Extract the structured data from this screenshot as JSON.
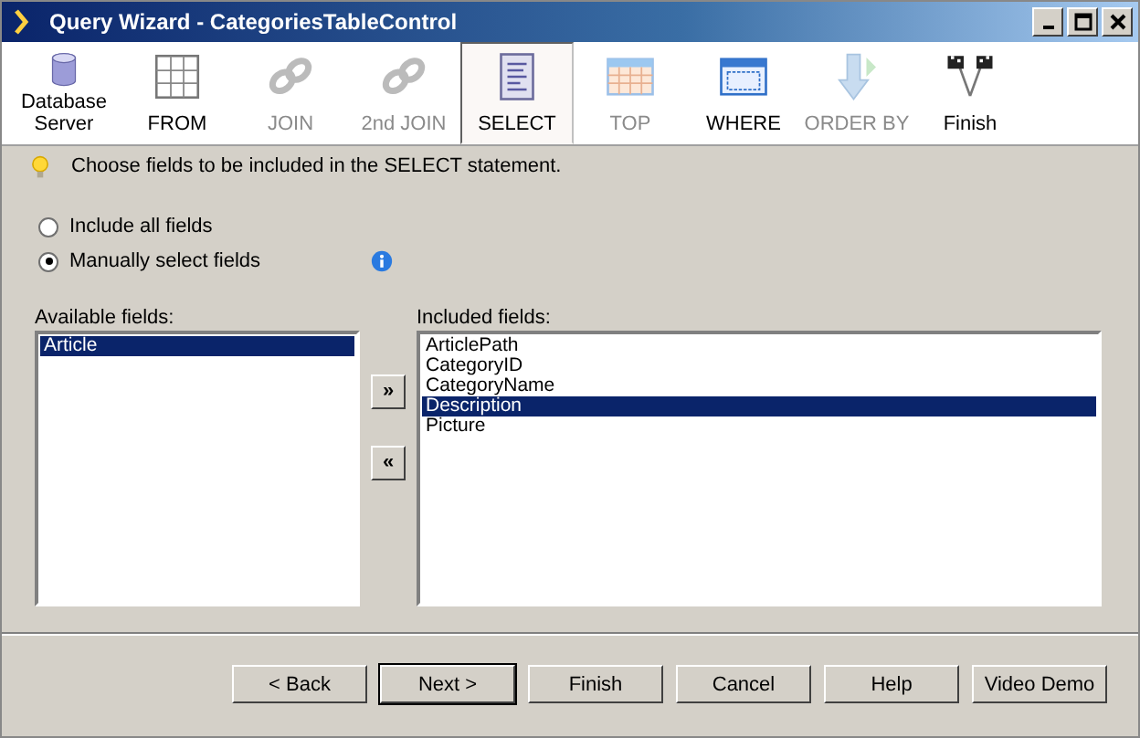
{
  "window": {
    "title": "Query Wizard - CategoriesTableControl"
  },
  "steps": [
    {
      "label": "Database Server",
      "disabled": false,
      "selected": false
    },
    {
      "label": "FROM",
      "disabled": false,
      "selected": false
    },
    {
      "label": "JOIN",
      "disabled": true,
      "selected": false
    },
    {
      "label": "2nd JOIN",
      "disabled": true,
      "selected": false
    },
    {
      "label": "SELECT",
      "disabled": false,
      "selected": true
    },
    {
      "label": "TOP",
      "disabled": true,
      "selected": false
    },
    {
      "label": "WHERE",
      "disabled": false,
      "selected": false
    },
    {
      "label": "ORDER BY",
      "disabled": true,
      "selected": false
    },
    {
      "label": "Finish",
      "disabled": false,
      "selected": false
    }
  ],
  "hint": "Choose fields to be included in the SELECT statement.",
  "options": [
    {
      "label": "Include all fields",
      "selected": false
    },
    {
      "label": "Manually select fields",
      "selected": true
    }
  ],
  "available": {
    "label": "Available fields:",
    "items": [
      {
        "label": "Article",
        "selected": true
      }
    ]
  },
  "move_buttons": [
    "»",
    "«"
  ],
  "included": {
    "label": "Included fields:",
    "items": [
      {
        "label": "ArticlePath",
        "selected": false
      },
      {
        "label": "CategoryID",
        "selected": false
      },
      {
        "label": "CategoryName",
        "selected": false
      },
      {
        "label": "Description",
        "selected": true
      },
      {
        "label": "Picture",
        "selected": false
      }
    ]
  },
  "buttons": [
    {
      "label": "< Back",
      "default": false
    },
    {
      "label": "Next >",
      "default": true
    },
    {
      "label": "Finish",
      "default": false
    },
    {
      "label": "Cancel",
      "default": false
    },
    {
      "label": "Help",
      "default": false
    },
    {
      "label": "Video Demo",
      "default": false
    }
  ]
}
